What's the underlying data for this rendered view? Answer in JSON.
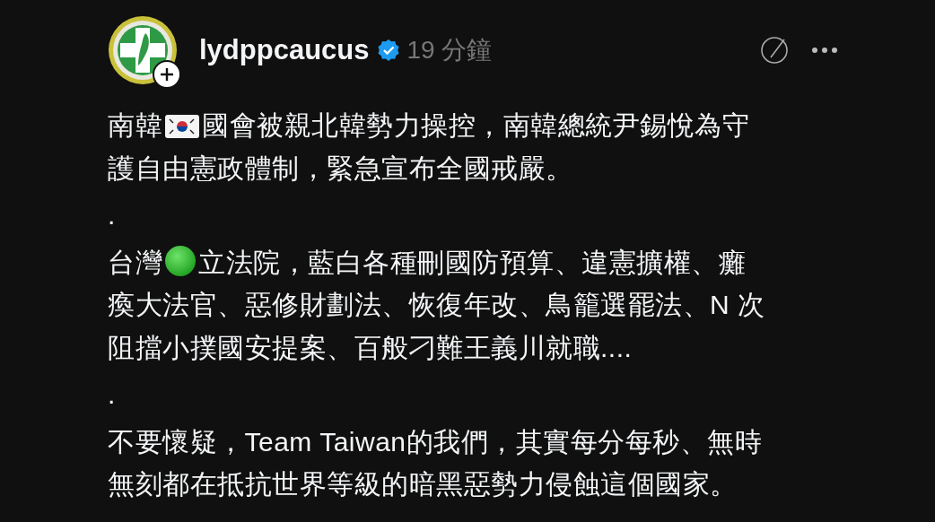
{
  "post": {
    "author": "lydppcaucus",
    "verified": true,
    "time": "19 分鐘",
    "paragraphs": [
      {
        "lines": [
          [
            {
              "kind": "text",
              "text": "南韓"
            },
            {
              "kind": "flag"
            },
            {
              "kind": "text",
              "text": "國會被親北韓勢力操控，南韓總統尹錫悅為守"
            }
          ],
          [
            {
              "kind": "text",
              "text": "護自由憲政體制，緊急宣布全國戒嚴。"
            }
          ]
        ]
      },
      {
        "lines": [
          [
            {
              "kind": "text",
              "text": "."
            }
          ]
        ]
      },
      {
        "lines": [
          [
            {
              "kind": "text",
              "text": "台灣"
            },
            {
              "kind": "dot"
            },
            {
              "kind": "text",
              "text": "立法院，藍白各種刪國防預算、違憲擴權、癱"
            }
          ],
          [
            {
              "kind": "text",
              "text": "瘓大法官、惡修財劃法、恢復年改、鳥籠選罷法、N 次"
            }
          ],
          [
            {
              "kind": "text",
              "text": "阻擋小撲國安提案、百般刁難王義川就職...."
            }
          ]
        ]
      },
      {
        "lines": [
          [
            {
              "kind": "text",
              "text": "."
            }
          ]
        ]
      },
      {
        "lines": [
          [
            {
              "kind": "text",
              "text": "不要懷疑，Team Taiwan的我們，其實每分每秒、無時"
            }
          ],
          [
            {
              "kind": "text",
              "text": "無刻都在抵抗世界等級的暗黑惡勢力侵蝕這個國家。"
            }
          ]
        ]
      }
    ]
  }
}
